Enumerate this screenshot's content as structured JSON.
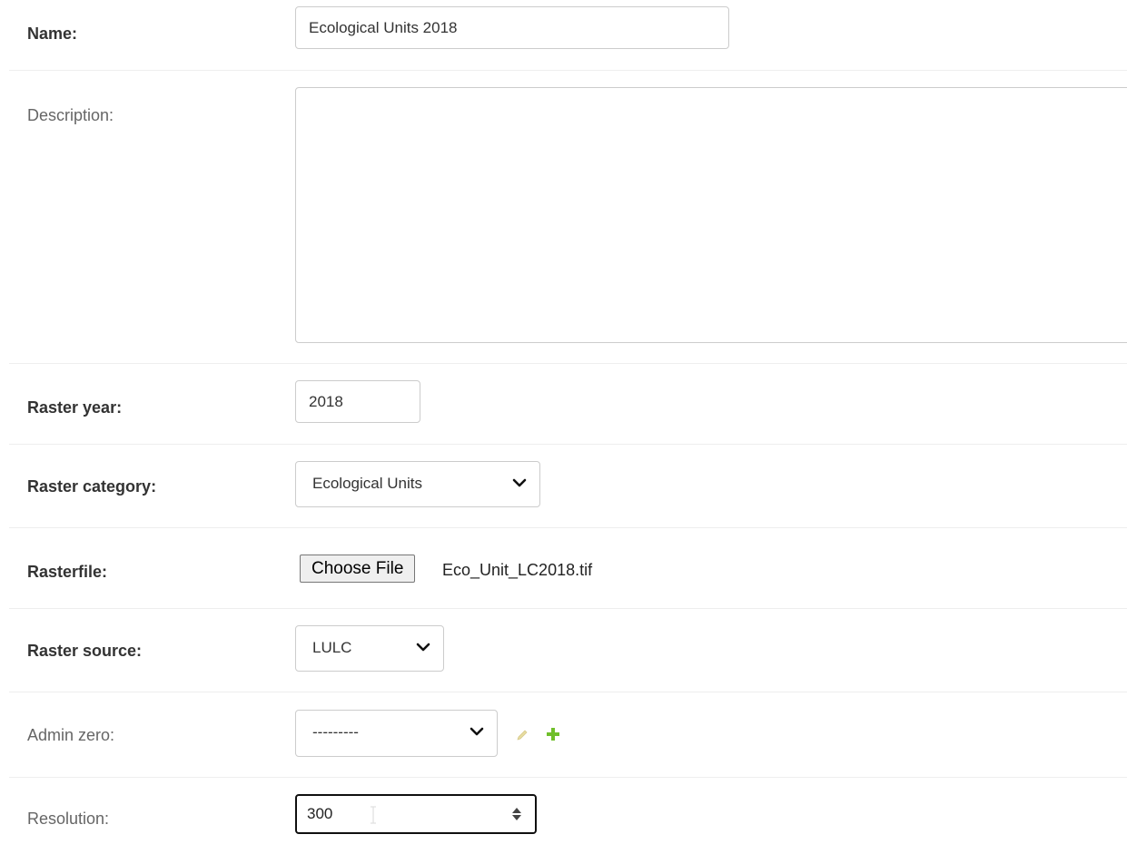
{
  "fields": {
    "name": {
      "label": "Name:",
      "value": "Ecological Units 2018"
    },
    "description": {
      "label": "Description:",
      "value": ""
    },
    "raster_year": {
      "label": "Raster year:",
      "value": "2018"
    },
    "raster_category": {
      "label": "Raster category:",
      "selected": "Ecological Units"
    },
    "rasterfile": {
      "label": "Rasterfile:",
      "button_label": "Choose File",
      "file_name": "Eco_Unit_LC2018.tif"
    },
    "raster_source": {
      "label": "Raster source:",
      "selected": "LULC"
    },
    "admin_zero": {
      "label": "Admin zero:",
      "selected": "---------"
    },
    "resolution": {
      "label": "Resolution:",
      "value": "300"
    }
  },
  "colors": {
    "pencil_icon": "#e6dca0",
    "plus_icon": "#70bf2b"
  }
}
